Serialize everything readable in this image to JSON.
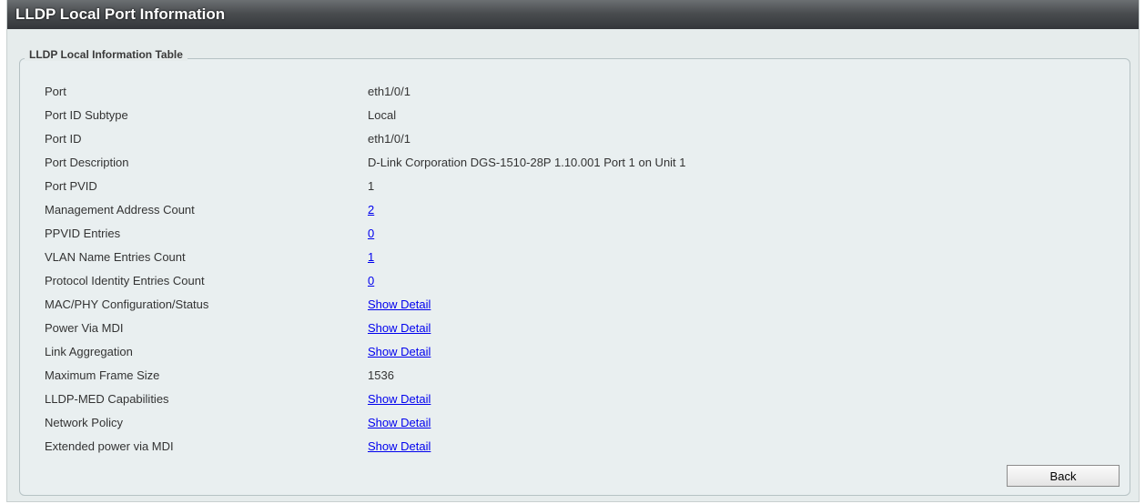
{
  "header": {
    "title": "LLDP Local Port Information"
  },
  "table": {
    "legend": "LLDP Local Information Table",
    "rows": [
      {
        "label": "Port",
        "value": "eth1/0/1",
        "link": false
      },
      {
        "label": "Port ID Subtype",
        "value": "Local",
        "link": false
      },
      {
        "label": "Port ID",
        "value": "eth1/0/1",
        "link": false
      },
      {
        "label": "Port Description",
        "value": "D-Link Corporation DGS-1510-28P 1.10.001 Port 1 on Unit 1",
        "link": false
      },
      {
        "label": "Port PVID",
        "value": "1",
        "link": false
      },
      {
        "label": "Management Address Count",
        "value": "2",
        "link": true
      },
      {
        "label": "PPVID Entries",
        "value": "0",
        "link": true
      },
      {
        "label": "VLAN Name Entries Count",
        "value": "1",
        "link": true
      },
      {
        "label": "Protocol Identity Entries Count",
        "value": "0",
        "link": true
      },
      {
        "label": "MAC/PHY Configuration/Status",
        "value": "Show Detail",
        "link": true
      },
      {
        "label": "Power Via MDI",
        "value": "Show Detail",
        "link": true
      },
      {
        "label": "Link Aggregation",
        "value": "Show Detail",
        "link": true
      },
      {
        "label": "Maximum Frame Size",
        "value": "1536",
        "link": false
      },
      {
        "label": "LLDP-MED Capabilities",
        "value": "Show Detail",
        "link": true
      },
      {
        "label": "Network Policy",
        "value": "Show Detail",
        "link": true
      },
      {
        "label": "Extended power via MDI",
        "value": "Show Detail",
        "link": true
      }
    ]
  },
  "actions": {
    "back_label": "Back"
  },
  "colors": {
    "link": "#0000ee",
    "panel_bg": "#e6ecec",
    "titlebar": "#3c3f42"
  }
}
